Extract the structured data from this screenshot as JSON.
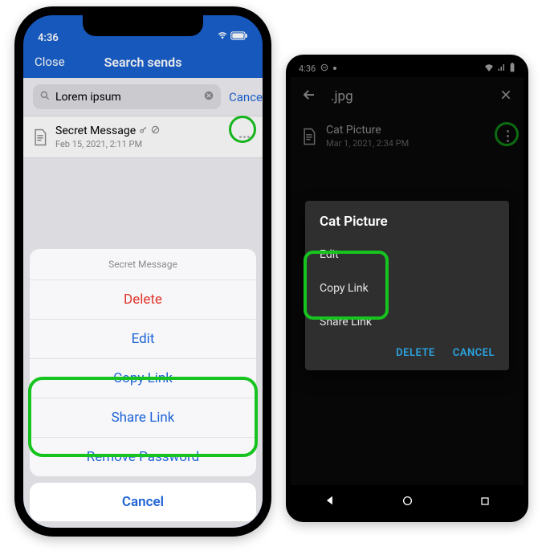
{
  "ios": {
    "statusbar": {
      "time": "4:36"
    },
    "navbar": {
      "close": "Close",
      "title": "Search sends"
    },
    "search": {
      "value": "Lorem ipsum",
      "cancel": "Cancel"
    },
    "item": {
      "name": "Secret Message",
      "date": "Feb 15, 2021, 2:11 PM"
    },
    "sheet": {
      "title": "Secret Message",
      "delete": "Delete",
      "edit": "Edit",
      "copy_link": "Copy Link",
      "share_link": "Share Link",
      "remove_password": "Remove Password",
      "cancel": "Cancel"
    }
  },
  "android": {
    "statusbar": {
      "time": "4:36"
    },
    "appbar": {
      "title": ".jpg"
    },
    "item": {
      "name": "Cat Picture",
      "date": "Mar 1, 2021, 2:34 PM"
    },
    "sheet": {
      "title": "Cat Picture",
      "edit": "Edit",
      "copy_link": "Copy Link",
      "share_link": "Share Link",
      "delete": "DELETE",
      "cancel": "CANCEL"
    }
  },
  "colors": {
    "ios_accent": "#1f63d6",
    "destructive": "#e0352b",
    "android_accent": "#2aa5e2",
    "highlight": "#17c41f"
  }
}
